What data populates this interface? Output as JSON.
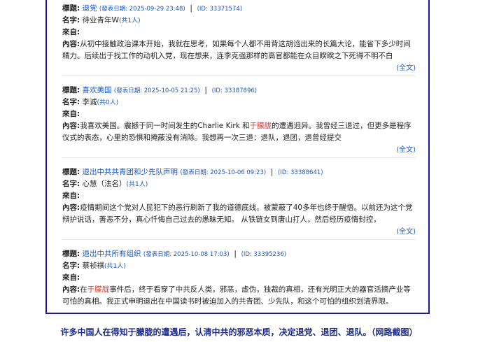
{
  "labels": {
    "title": "標題:",
    "name": "名字:",
    "from": "來自:",
    "content": "內容:",
    "more": "(全文)"
  },
  "entries": [
    {
      "title": "退党",
      "date": "(發表日期: 2025-09-29 23:48)",
      "id": "(ID: 33371574)",
      "name": "待业青年W",
      "count": "(共1人)",
      "content_pre": "从初中接触政治课本开始，我就在思考，如果每个人都不用背这胡诌出来的长篇大论，能省下多少时间精力。后续出于找工作的动机入党，现在想来，连李克强那样的高官都能在众目睽睽之下死得不明不白",
      "highlight": "",
      "content_post": ""
    },
    {
      "title": "喜欢美国",
      "date": "(發表日期: 2025-10-05 21:25)",
      "id": "(ID: 33387896)",
      "name": "李诚",
      "count": "(共0人)",
      "content_pre": "我喜欢美国。震撼于同一时间发生的Charlie Kirk 和",
      "highlight": "于朦胧",
      "content_post": "的遭遇迥异。我曾经三退过，但更多是程序仪式的表态，心里的恐惧和掩蔽没有消除。我想再一次三退：退队，退团，退曾经提交"
    },
    {
      "title": "退出中共共青团和少先队声明",
      "date": "(發表日期: 2025-10-06 09:23)",
      "id": "(ID: 33388641)",
      "name": "心慧（法名）",
      "count": "(共1人)",
      "content_pre": "疫情期间这个党对人民犯下的恶行刷新了我的道德底线。被蒙蔽了40多年也终于醒悟。以前还为这个党辩护说话，善恶不分，真心忏悔自己过去的愚昧无知。 从铁链女到唐山打人，然后经历疫情封控，",
      "highlight": "",
      "content_post": ""
    },
    {
      "title": "退出中共所有组织",
      "date": "(發表日期: 2025-10-08 17:03)",
      "id": "(ID: 33395236)",
      "name": "蔡祯祺",
      "count": "(共1人)",
      "content_pre": "在",
      "highlight": "于朦胧",
      "content_post": "事件后，终于看穿了中共反人类，邪恶，虚伪，独裁的真相，还有光明正大的器官活摘产业等可怕的真相。我正式申明退出在中国读书时被迫加入的共青团、少先队，和这个可怕的组织划清界限。"
    }
  ],
  "caption": "许多中国人在得知于朦胧的遭遇后，认清中共的邪恶本质，决定退党、退团、退队。（网路截图）"
}
